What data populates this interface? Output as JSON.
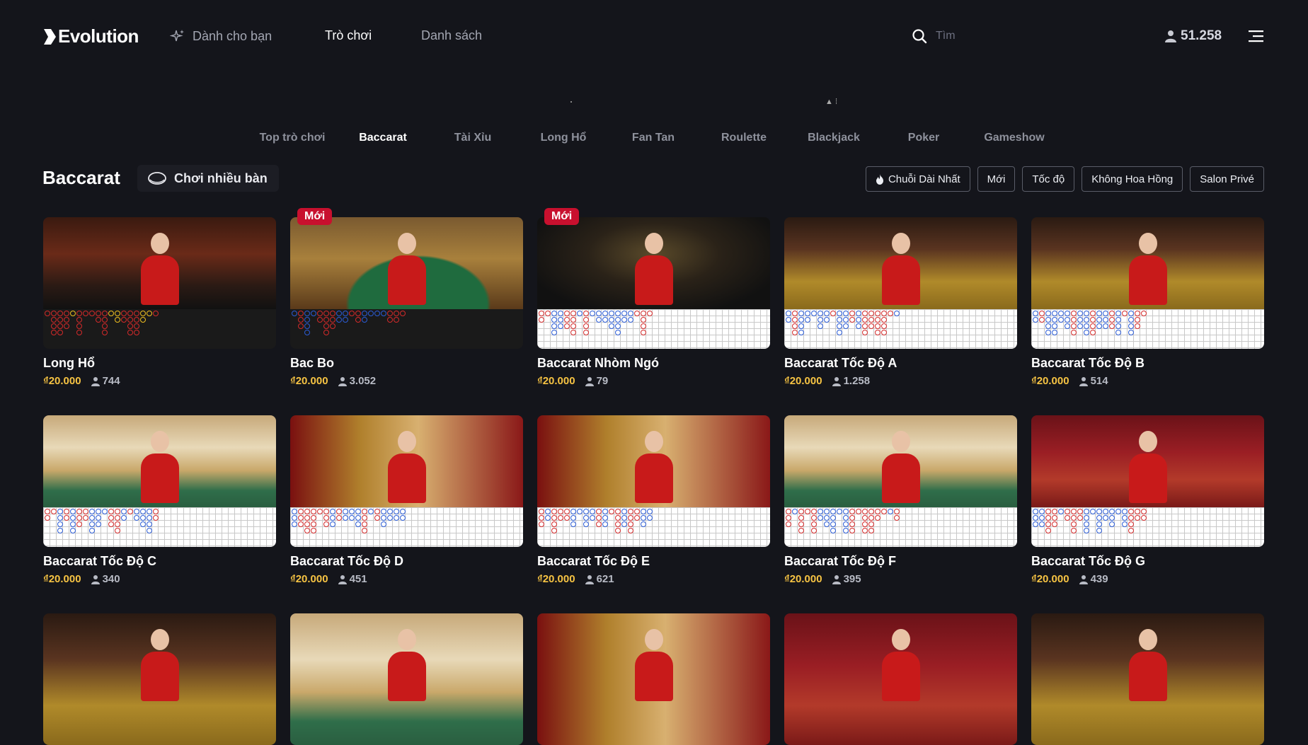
{
  "header": {
    "logo_text": "Evolution",
    "nav": [
      {
        "label": "Dành cho bạn"
      },
      {
        "label": "Trò chơi"
      },
      {
        "label": "Danh sách"
      }
    ],
    "search_placeholder": "Tìm",
    "players_total": "51.258"
  },
  "category_tabs": [
    "Top trò chơi",
    "Baccarat",
    "Tài Xỉu",
    "Long Hổ",
    "Fan Tan",
    "Roulette",
    "Blackjack",
    "Poker",
    "Gameshow"
  ],
  "active_tab": "Baccarat",
  "section": {
    "title": "Baccarat",
    "multi_table_label": "Chơi nhiều bàn"
  },
  "filters": [
    "Chuỗi Dài Nhất",
    "Mới",
    "Tốc độ",
    "Không Hoa Hồng",
    "Salon Privé"
  ],
  "new_badge": "Mới",
  "colors": {
    "background": "#14151b",
    "stake": "#f6c343",
    "badge": "#c8102e",
    "bead_red": "#d42a2a",
    "bead_blue": "#2b5cd6",
    "bead_yellow": "#f0c020"
  },
  "games": [
    {
      "name": "Long Hổ",
      "stake": "₫20.000",
      "players": "744",
      "is_new": false,
      "road": "dark",
      "scene": "dragon"
    },
    {
      "name": "Bac Bo",
      "stake": "₫20.000",
      "players": "3.052",
      "is_new": true,
      "road": "dark",
      "scene": "green"
    },
    {
      "name": "Baccarat Nhòm Ngó",
      "stake": "₫20.000",
      "players": "79",
      "is_new": true,
      "road": "light",
      "scene": "dark"
    },
    {
      "name": "Baccarat Tốc Độ A",
      "stake": "₫20.000",
      "players": "1.258",
      "is_new": false,
      "road": "light",
      "scene": "gold"
    },
    {
      "name": "Baccarat Tốc Độ B",
      "stake": "₫20.000",
      "players": "514",
      "is_new": false,
      "road": "light",
      "scene": "gold"
    },
    {
      "name": "Baccarat Tốc Độ C",
      "stake": "₫20.000",
      "players": "340",
      "is_new": false,
      "road": "light",
      "scene": "cream"
    },
    {
      "name": "Baccarat Tốc Độ D",
      "stake": "₫20.000",
      "players": "451",
      "is_new": false,
      "road": "light",
      "scene": "redgold"
    },
    {
      "name": "Baccarat Tốc Độ E",
      "stake": "₫20.000",
      "players": "621",
      "is_new": false,
      "road": "light",
      "scene": "redgold"
    },
    {
      "name": "Baccarat Tốc Độ F",
      "stake": "₫20.000",
      "players": "395",
      "is_new": false,
      "road": "light",
      "scene": "cream"
    },
    {
      "name": "Baccarat Tốc Độ G",
      "stake": "₫20.000",
      "players": "439",
      "is_new": false,
      "road": "light",
      "scene": "red"
    },
    {
      "name": "",
      "stake": "",
      "players": "",
      "is_new": false,
      "road": "none",
      "scene": "gold"
    },
    {
      "name": "",
      "stake": "",
      "players": "",
      "is_new": false,
      "road": "none",
      "scene": "cream"
    },
    {
      "name": "",
      "stake": "",
      "players": "",
      "is_new": false,
      "road": "none",
      "scene": "redgold"
    },
    {
      "name": "",
      "stake": "",
      "players": "",
      "is_new": false,
      "road": "none",
      "scene": "red"
    },
    {
      "name": "",
      "stake": "",
      "players": "",
      "is_new": false,
      "road": "none",
      "scene": "gold"
    }
  ]
}
